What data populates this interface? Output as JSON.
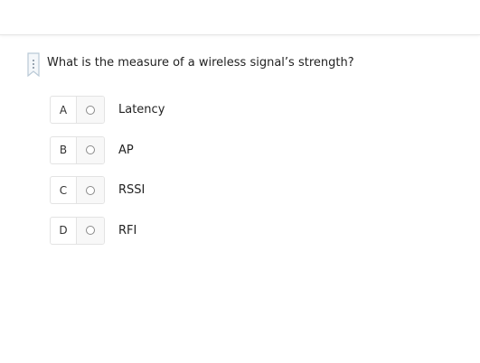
{
  "question": {
    "text": "What is the measure of a wireless signal’s strength?",
    "bookmark_icon": "bookmark-flag-icon"
  },
  "options": [
    {
      "letter": "A",
      "label": "Latency"
    },
    {
      "letter": "B",
      "label": "AP"
    },
    {
      "letter": "C",
      "label": "RSSI"
    },
    {
      "letter": "D",
      "label": "RFI"
    }
  ],
  "colors": {
    "border": "#e3e3e3",
    "bookmark": "#b9c9d6",
    "radio": "#8a8a8a"
  }
}
